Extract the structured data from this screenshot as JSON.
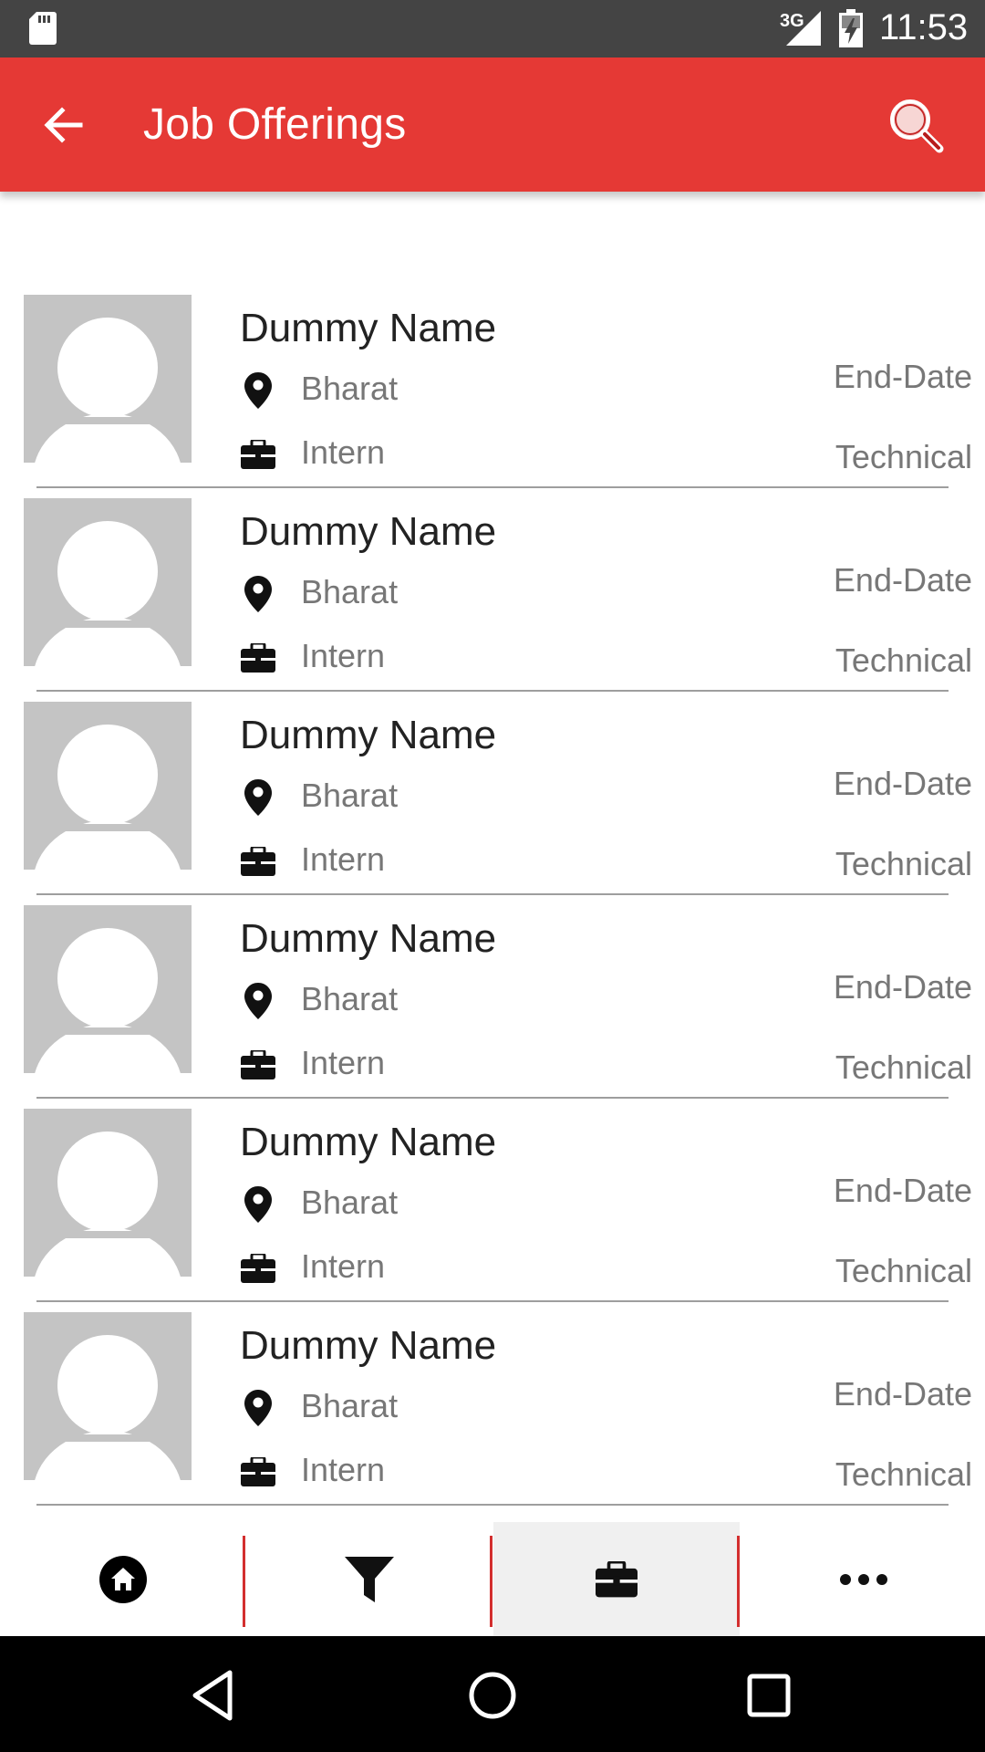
{
  "status_bar": {
    "network": "3G",
    "time": "11:53",
    "icons": [
      "sd-card-icon",
      "signal-icon",
      "battery-charging-icon"
    ]
  },
  "toolbar": {
    "title": "Job Offerings",
    "back_icon": "back-arrow-icon",
    "search_icon": "search-icon",
    "color": "#e53935"
  },
  "jobs": [
    {
      "name": "Dummy Name",
      "location": "Bharat",
      "type": "Intern",
      "end_date": "End-Date",
      "category": "Technical"
    },
    {
      "name": "Dummy Name",
      "location": "Bharat",
      "type": "Intern",
      "end_date": "End-Date",
      "category": "Technical"
    },
    {
      "name": "Dummy Name",
      "location": "Bharat",
      "type": "Intern",
      "end_date": "End-Date",
      "category": "Technical"
    },
    {
      "name": "Dummy Name",
      "location": "Bharat",
      "type": "Intern",
      "end_date": "End-Date",
      "category": "Technical"
    },
    {
      "name": "Dummy Name",
      "location": "Bharat",
      "type": "Intern",
      "end_date": "End-Date",
      "category": "Technical"
    },
    {
      "name": "Dummy Name",
      "location": "Bharat",
      "type": "Intern",
      "end_date": "End-Date",
      "category": "Technical"
    }
  ],
  "bottom_nav": {
    "tabs": [
      {
        "icon": "home-icon"
      },
      {
        "icon": "filter-icon"
      },
      {
        "icon": "briefcase-icon",
        "active": true
      },
      {
        "icon": "more-icon"
      }
    ],
    "separator_color": "#d32f2f"
  },
  "system_nav": [
    "back-triangle-icon",
    "home-circle-icon",
    "recents-square-icon"
  ]
}
